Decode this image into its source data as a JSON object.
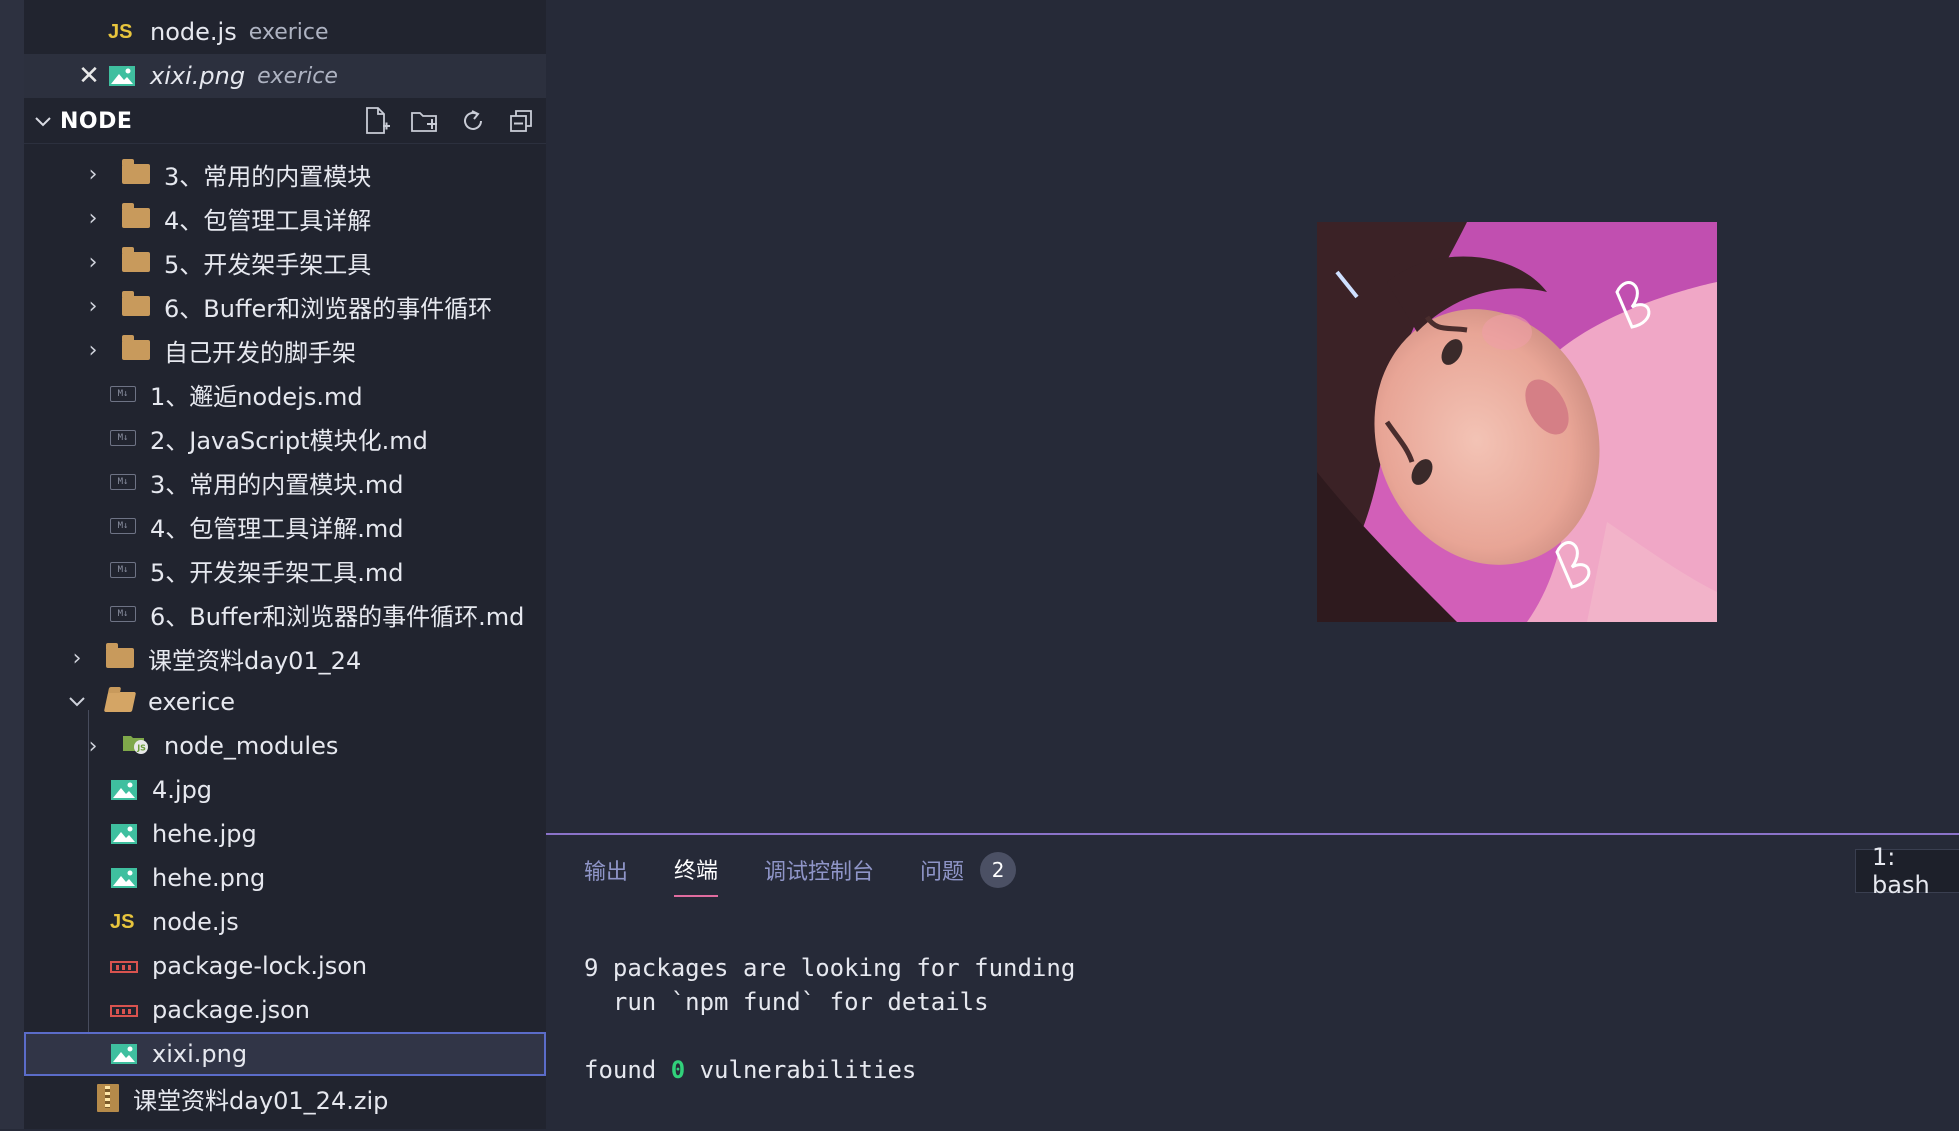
{
  "open_editors": [
    {
      "name": "node.js",
      "folder": "exerice",
      "icon": "js-icon",
      "active": false,
      "italic": false
    },
    {
      "name": "xixi.png",
      "folder": "exerice",
      "icon": "image-icon",
      "active": true,
      "italic": true,
      "close_glyph": "✕"
    }
  ],
  "explorer": {
    "section_title": "NODE",
    "tools": [
      "new-file-icon",
      "new-folder-icon",
      "refresh-icon",
      "collapse-all-icon"
    ],
    "items": [
      {
        "label": "3、常用的内置模块",
        "type": "folder",
        "depth": 1
      },
      {
        "label": "4、包管理工具详解",
        "type": "folder",
        "depth": 1
      },
      {
        "label": "5、开发架手架工具",
        "type": "folder",
        "depth": 1
      },
      {
        "label": "6、Buffer和浏览器的事件循环",
        "type": "folder",
        "depth": 1
      },
      {
        "label": "自己开发的脚手架",
        "type": "folder",
        "depth": 1
      },
      {
        "label": "1、邂逅nodejs.md",
        "type": "md",
        "depth": 1
      },
      {
        "label": "2、JavaScript模块化.md",
        "type": "md",
        "depth": 1
      },
      {
        "label": "3、常用的内置模块.md",
        "type": "md",
        "depth": 1
      },
      {
        "label": "4、包管理工具详解.md",
        "type": "md",
        "depth": 1
      },
      {
        "label": "5、开发架手架工具.md",
        "type": "md",
        "depth": 1
      },
      {
        "label": "6、Buffer和浏览器的事件循环.md",
        "type": "md",
        "depth": 1
      },
      {
        "label": "课堂资料day01_24",
        "type": "folder",
        "depth": 0
      },
      {
        "label": "exerice",
        "type": "folder-open",
        "depth": 0
      },
      {
        "label": "node_modules",
        "type": "node-folder",
        "depth": 1
      },
      {
        "label": "4.jpg",
        "type": "image",
        "depth": 1
      },
      {
        "label": "hehe.jpg",
        "type": "image",
        "depth": 1
      },
      {
        "label": "hehe.png",
        "type": "image",
        "depth": 1
      },
      {
        "label": "node.js",
        "type": "js",
        "depth": 1
      },
      {
        "label": "package-lock.json",
        "type": "json",
        "depth": 1
      },
      {
        "label": "package.json",
        "type": "json",
        "depth": 1
      },
      {
        "label": "xixi.png",
        "type": "image",
        "depth": 1,
        "selected": true
      },
      {
        "label": "课堂资料day01_24.zip",
        "type": "zip",
        "depth": 0
      }
    ]
  },
  "icons": {
    "js_glyph": "JS",
    "md_glyph": "M↓"
  },
  "panel": {
    "tabs": [
      {
        "label": "输出",
        "active": false
      },
      {
        "label": "终端",
        "active": true
      },
      {
        "label": "调试控制台",
        "active": false
      },
      {
        "label": "问题",
        "active": false
      }
    ],
    "problems_count": "2",
    "terminal_selector": "1: bash",
    "terminal_lines": {
      "l1": "9 packages are looking for funding",
      "l2": "  run `npm fund` for details",
      "l3_prefix": "found ",
      "l3_count": "0",
      "l3_suffix": " vulnerabilities"
    }
  },
  "colors": {
    "accent": "#8b73c9",
    "selected_outline": "#5b6cc9",
    "active_tab_underline": "#e06c9f",
    "folder": "#c89a5c",
    "js": "#e8c53d"
  }
}
